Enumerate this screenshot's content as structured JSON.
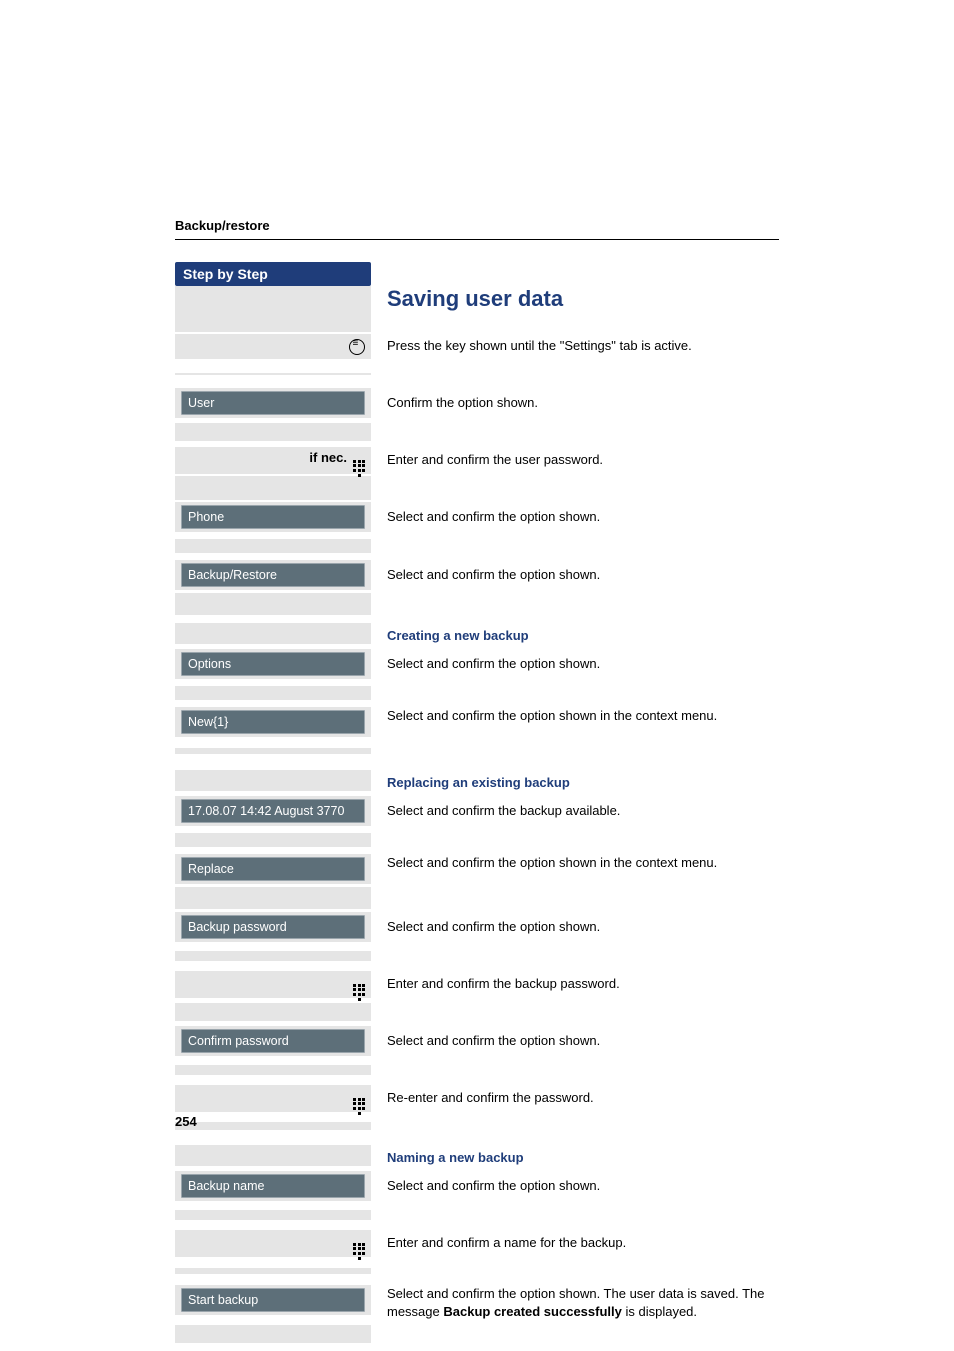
{
  "runningHeader": "Backup/restore",
  "stepHeader": "Step by Step",
  "title": "Saving user data",
  "pageNumber": "254",
  "ifNecLabel": "if nec.",
  "rows": [
    {
      "leftType": "icon-circle",
      "right": "Press the key shown until the \"Settings\" tab is active."
    },
    {
      "leftType": "box",
      "leftText": "User",
      "right": "Confirm the option shown."
    },
    {
      "leftType": "ifnec-keypad",
      "right": "Enter and confirm the user password."
    },
    {
      "leftType": "box",
      "leftText": "Phone",
      "right": "Select and confirm the option shown."
    },
    {
      "leftType": "box",
      "leftText": "Backup/Restore",
      "right": "Select and confirm the option shown."
    },
    {
      "leftType": "subhead",
      "right": "Creating a new backup"
    },
    {
      "leftType": "box",
      "leftText": "Options",
      "right": "Select and confirm the option shown."
    },
    {
      "leftType": "box",
      "leftText": "New{1}",
      "right": "Select and confirm the option shown in the context menu."
    },
    {
      "leftType": "subhead",
      "right": "Replacing an existing backup"
    },
    {
      "leftType": "box",
      "leftText": "17.08.07 14:42 August 3770",
      "right": "Select and confirm the backup available."
    },
    {
      "leftType": "box",
      "leftText": "Replace",
      "right": "Select and confirm the option shown in the context menu."
    },
    {
      "leftType": "box",
      "leftText": "Backup password",
      "right": "Select and confirm the option shown."
    },
    {
      "leftType": "keypad",
      "right": "Enter and confirm the backup password."
    },
    {
      "leftType": "box",
      "leftText": "Confirm password",
      "right": "Select and confirm the option shown."
    },
    {
      "leftType": "keypad",
      "right": "Re-enter and confirm the password."
    },
    {
      "leftType": "subhead",
      "right": "Naming a new backup"
    },
    {
      "leftType": "box",
      "leftText": "Backup name",
      "right": "Select and confirm the option shown."
    },
    {
      "leftType": "keypad",
      "right": "Enter and confirm a name for the backup."
    },
    {
      "leftType": "box",
      "leftText": "Start backup",
      "rightHtmlKey": "finalRow"
    }
  ],
  "finalRow": {
    "pre": "Select and confirm the option shown. The user data is saved. The message ",
    "bold": "Backup created successfully",
    "post": " is displayed."
  }
}
